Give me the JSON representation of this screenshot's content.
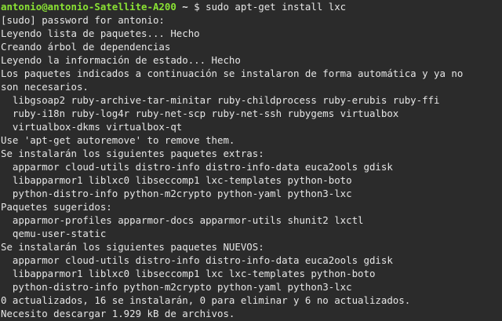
{
  "prompt": {
    "user_host": "antonio@antonio-Satellite-A200",
    "separator": " ~ ",
    "dollar": "$ ",
    "command": "sudo apt-get install lxc"
  },
  "output_lines": [
    "[sudo] password for antonio:",
    "Leyendo lista de paquetes... Hecho",
    "Creando árbol de dependencias",
    "Leyendo la información de estado... Hecho",
    "Los paquetes indicados a continuación se instalaron de forma automática y ya no",
    "son necesarios.",
    "  libgsoap2 ruby-archive-tar-minitar ruby-childprocess ruby-erubis ruby-ffi",
    "  ruby-i18n ruby-log4r ruby-net-scp ruby-net-ssh rubygems virtualbox",
    "  virtualbox-dkms virtualbox-qt",
    "Use 'apt-get autoremove' to remove them.",
    "Se instalarán los siguientes paquetes extras:",
    "  apparmor cloud-utils distro-info distro-info-data euca2ools gdisk",
    "  libapparmor1 liblxc0 libseccomp1 lxc-templates python-boto",
    "  python-distro-info python-m2crypto python-yaml python3-lxc",
    "Paquetes sugeridos:",
    "  apparmor-profiles apparmor-docs apparmor-utils shunit2 lxctl",
    "  qemu-user-static",
    "Se instalarán los siguientes paquetes NUEVOS:",
    "  apparmor cloud-utils distro-info distro-info-data euca2ools gdisk",
    "  libapparmor1 liblxc0 libseccomp1 lxc lxc-templates python-boto",
    "  python-distro-info python-m2crypto python-yaml python3-lxc",
    "0 actualizados, 16 se instalarán, 0 para eliminar y 6 no actualizados.",
    "Necesito descargar 1.929 kB de archivos."
  ],
  "colors": {
    "background": "#2b2b2b",
    "text": "#e6e6e6",
    "user_host": "#8ae234",
    "path": "#729fcf"
  }
}
